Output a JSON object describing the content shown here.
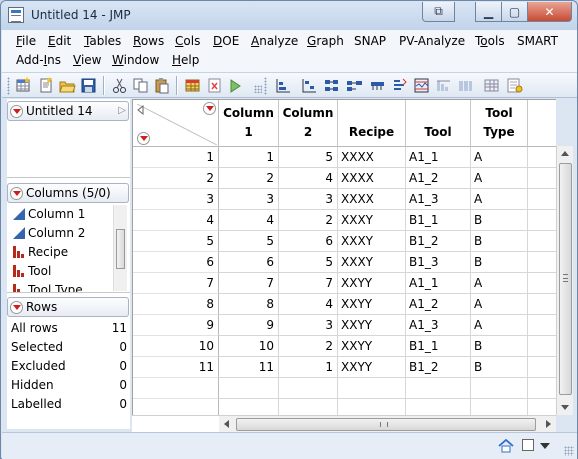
{
  "window": {
    "title": "Untitled 14 - JMP",
    "controls": {
      "restore_app": "⧉",
      "minimize": "▁",
      "maximize": "▢",
      "close": "✕"
    }
  },
  "menu": [
    {
      "pre": "",
      "u": "F",
      "post": "ile"
    },
    {
      "pre": "",
      "u": "E",
      "post": "dit"
    },
    {
      "pre": "",
      "u": "T",
      "post": "ables"
    },
    {
      "pre": "",
      "u": "R",
      "post": "ows"
    },
    {
      "pre": "",
      "u": "C",
      "post": "ols"
    },
    {
      "pre": "",
      "u": "D",
      "post": "OE"
    },
    {
      "pre": "",
      "u": "A",
      "post": "nalyze"
    },
    {
      "pre": "",
      "u": "G",
      "post": "raph"
    },
    {
      "pre": "SNAP",
      "u": "",
      "post": ""
    },
    {
      "pre": "PV-Analyze",
      "u": "",
      "post": ""
    },
    {
      "pre": "T",
      "u": "o",
      "post": "ols"
    },
    {
      "pre": "SMART",
      "u": "",
      "post": ""
    },
    {
      "pre": "Add-",
      "u": "I",
      "post": "ns"
    },
    {
      "pre": "",
      "u": "V",
      "post": "iew"
    },
    {
      "pre": "",
      "u": "W",
      "post": "indow"
    },
    {
      "pre": "",
      "u": "H",
      "post": "elp"
    }
  ],
  "colors": {
    "red_triangle": "#d21d1d",
    "continuous_icon": "#3565b1",
    "nominal_icon": "#b42a1c",
    "accent": "#3a74c4"
  },
  "panels": {
    "table": {
      "name": "Untitled 14"
    },
    "columns": {
      "header": "Columns (5/0)",
      "items": [
        {
          "label": "Column 1",
          "icon": "continuous-icon"
        },
        {
          "label": "Column 2",
          "icon": "continuous-icon"
        },
        {
          "label": "Recipe",
          "icon": "nominal-icon"
        },
        {
          "label": "Tool",
          "icon": "nominal-icon"
        },
        {
          "label": "Tool Type",
          "icon": "nominal-icon"
        }
      ]
    },
    "rows": {
      "header": "Rows",
      "stats": [
        {
          "label": "All rows",
          "value": "11"
        },
        {
          "label": "Selected",
          "value": "0"
        },
        {
          "label": "Excluded",
          "value": "0"
        },
        {
          "label": "Hidden",
          "value": "0"
        },
        {
          "label": "Labelled",
          "value": "0"
        }
      ]
    }
  },
  "table": {
    "columns": [
      {
        "line1": "Column",
        "line2": "1"
      },
      {
        "line1": "Column",
        "line2": "2"
      },
      {
        "line1": "",
        "line2": "Recipe"
      },
      {
        "line1": "",
        "line2": "Tool"
      },
      {
        "line1": "Tool",
        "line2": "Type"
      }
    ],
    "rows": [
      {
        "n": "1",
        "c1": "1",
        "c2": "5",
        "recipe": "XXXX",
        "tool": "A1_1",
        "type": "A"
      },
      {
        "n": "2",
        "c1": "2",
        "c2": "4",
        "recipe": "XXXX",
        "tool": "A1_2",
        "type": "A"
      },
      {
        "n": "3",
        "c1": "3",
        "c2": "3",
        "recipe": "XXXX",
        "tool": "A1_3",
        "type": "A"
      },
      {
        "n": "4",
        "c1": "4",
        "c2": "2",
        "recipe": "XXXY",
        "tool": "B1_1",
        "type": "B"
      },
      {
        "n": "5",
        "c1": "5",
        "c2": "6",
        "recipe": "XXXY",
        "tool": "B1_2",
        "type": "B"
      },
      {
        "n": "6",
        "c1": "6",
        "c2": "5",
        "recipe": "XXXY",
        "tool": "B1_3",
        "type": "B"
      },
      {
        "n": "7",
        "c1": "7",
        "c2": "7",
        "recipe": "XXYY",
        "tool": "A1_1",
        "type": "A"
      },
      {
        "n": "8",
        "c1": "8",
        "c2": "4",
        "recipe": "XXYY",
        "tool": "A1_2",
        "type": "A"
      },
      {
        "n": "9",
        "c1": "9",
        "c2": "3",
        "recipe": "XXYY",
        "tool": "A1_3",
        "type": "A"
      },
      {
        "n": "10",
        "c1": "10",
        "c2": "2",
        "recipe": "XXYY",
        "tool": "B1_1",
        "type": "B"
      },
      {
        "n": "11",
        "c1": "11",
        "c2": "1",
        "recipe": "XXYY",
        "tool": "B1_2",
        "type": "B"
      }
    ]
  }
}
